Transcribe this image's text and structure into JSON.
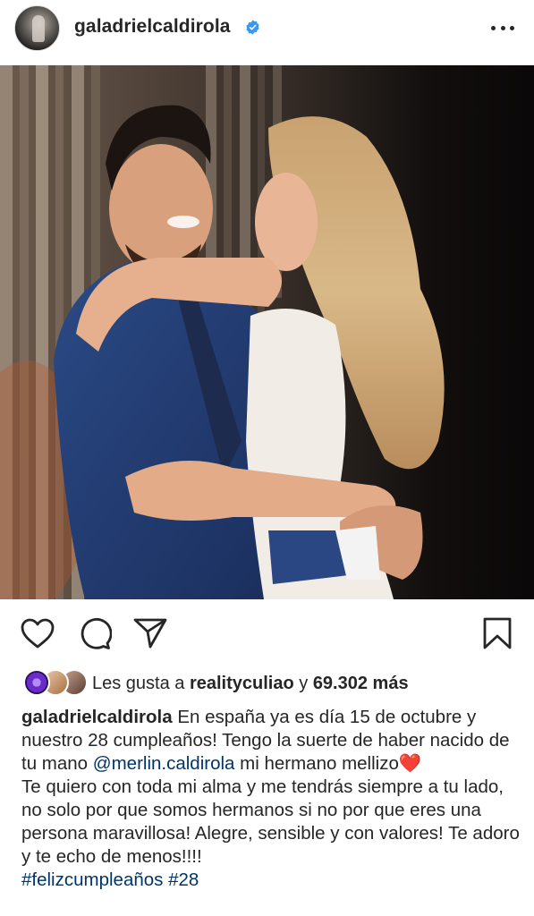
{
  "post": {
    "username": "galadrielcaldirola",
    "verified": true
  },
  "actions": {
    "like": "heart-outline",
    "comment": "speech-bubble",
    "share": "paper-plane",
    "save": "bookmark"
  },
  "likes": {
    "prefix": "Les gusta a ",
    "liker": "realityculiao",
    "connector": " y ",
    "count": "69.302 más"
  },
  "caption": {
    "username": "galadrielcaldirola",
    "line1": " En españa ya es día 15 de octubre y nuestro 28 cumpleaños! Tengo la suerte de haber nacido de tu mano ",
    "mention": "@merlin.caldirola",
    "line2": " mi hermano mellizo",
    "heart": "❤️",
    "paragraph2": "Te quiero con toda mi alma y me tendrás siempre a tu lado, no solo por que somos hermanos si no por que eres una persona maravillosa! Alegre, sensible y con valores! Te adoro y te echo de menos!!!!",
    "hashtags": "#felizcumpleaños #28"
  },
  "colors": {
    "text": "#262626",
    "link": "#003569",
    "verified": "#3897f0",
    "heart": "#e0323a"
  }
}
